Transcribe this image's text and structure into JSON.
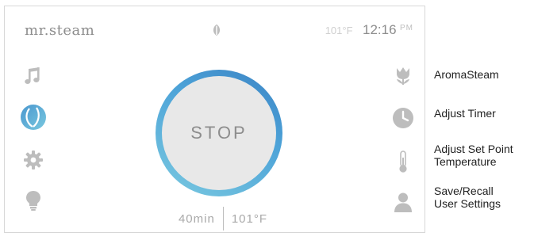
{
  "header": {
    "brand": "mr.steam",
    "temperature": "101°F",
    "time": "12:16",
    "ampm": "PM",
    "leaf_icon": "steam-leaf-icon"
  },
  "left_nav": [
    {
      "name": "music",
      "icon": "music-note-icon",
      "active": false
    },
    {
      "name": "steam",
      "icon": "steam-leaf-icon",
      "active": true
    },
    {
      "name": "settings",
      "icon": "gear-icon",
      "active": false
    },
    {
      "name": "light",
      "icon": "light-bulb-icon",
      "active": false
    }
  ],
  "right_nav": [
    {
      "name": "aromasteam",
      "icon": "tulip-icon"
    },
    {
      "name": "timer",
      "icon": "clock-icon"
    },
    {
      "name": "temperature",
      "icon": "thermometer-icon"
    },
    {
      "name": "user",
      "icon": "user-icon"
    }
  ],
  "dial": {
    "label": "STOP",
    "duration": "40min",
    "setpoint": "101°F"
  },
  "callouts": {
    "aromasteam": "AromaSteam",
    "adjust_timer": "Adjust Timer",
    "set_point_line1": "Adjust Set Point",
    "set_point_line2": "Temperature",
    "save_recall_line1": "Save/Recall",
    "save_recall_line2": "User Settings"
  },
  "colors": {
    "icon_gray": "#bdbdbd",
    "accent_blue": "#4da3d8",
    "accent_light": "#7ac9e0"
  }
}
